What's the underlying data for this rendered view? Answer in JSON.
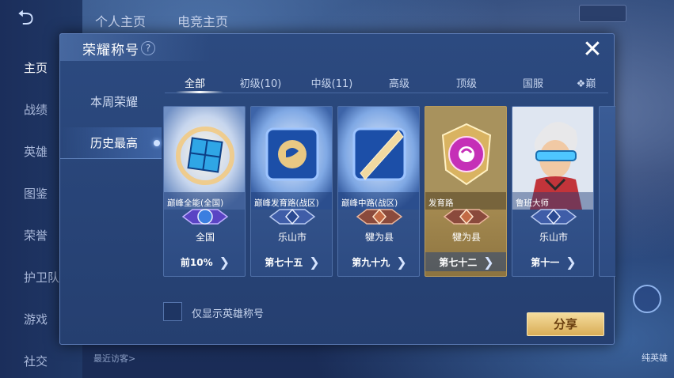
{
  "background": {
    "nav_items": [
      "主页",
      "战绩",
      "英雄",
      "图鉴",
      "荣誉",
      "护卫队",
      "游戏",
      "社交"
    ],
    "top_tabs": [
      "个人主页",
      "电竞主页"
    ],
    "visitor_label": "最近访客>",
    "right_label": "纯英雄"
  },
  "dialog": {
    "title": "荣耀称号",
    "help": "?",
    "close": "✕"
  },
  "categories": [
    {
      "label": "本周荣耀"
    },
    {
      "label": "历史最高"
    }
  ],
  "tabs": [
    "全部",
    "初级(10)",
    "中级(11)",
    "高级",
    "顶级",
    "国服",
    "巅"
  ],
  "cards": [
    {
      "name": "巅峰全能(全国)",
      "region": "全国",
      "rank": "前10%",
      "art": "blue-cube"
    },
    {
      "name": "巅峰发育路(战区)",
      "region": "乐山市",
      "rank": "第七十五",
      "art": "blue-frame"
    },
    {
      "name": "巅峰中路(战区)",
      "region": "犍为县",
      "rank": "第九十九",
      "art": "blue-slash"
    },
    {
      "name": "发育路",
      "region": "犍为县",
      "rank": "第七十二",
      "art": "purple-shield"
    },
    {
      "name": "鲁班大师",
      "region": "乐山市",
      "rank": "第十一",
      "art": "hero"
    }
  ],
  "filter_label": "仅显示英雄称号",
  "share_label": "分享",
  "colors": {
    "accent": "#d9ad57",
    "panel": "#2c4a80"
  }
}
